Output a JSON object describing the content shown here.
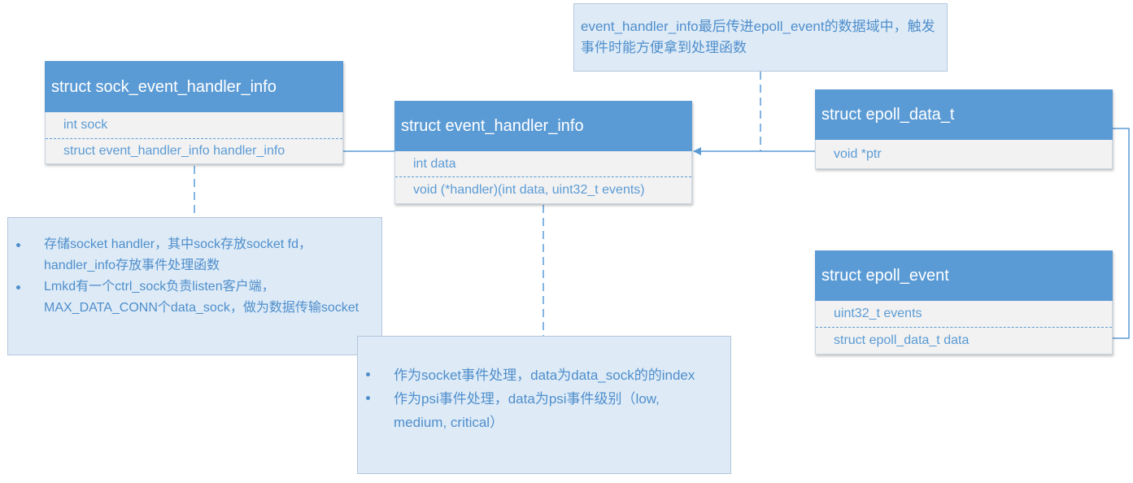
{
  "structs": {
    "sock_event_handler_info": {
      "title": "struct sock_event_handler_info",
      "fields": [
        "int sock",
        "struct event_handler_info handler_info"
      ]
    },
    "event_handler_info": {
      "title": "struct event_handler_info",
      "fields": [
        "int data",
        "void (*handler)(int data, uint32_t events)"
      ]
    },
    "epoll_data_t": {
      "title": "struct epoll_data_t",
      "fields": [
        "void *ptr"
      ]
    },
    "epoll_event": {
      "title": "struct epoll_event",
      "fields": [
        "uint32_t events",
        "struct epoll_data_t data"
      ]
    }
  },
  "notes": {
    "top": "event_handler_info最后传进epoll_event的数据域中，触发事件时能方便拿到处理函数",
    "left": [
      "存储socket handler，其中sock存放socket fd，handler_info存放事件处理函数",
      "Lmkd有一个ctrl_sock负责listen客户端，MAX_DATA_CONN个data_sock，做为数据传输socket"
    ],
    "middle": [
      "作为socket事件处理，data为data_sock的的index",
      "作为psi事件处理，data为psi事件级别（low, medium, critical）"
    ]
  },
  "colors": {
    "header": "#5b9bd5",
    "field_text": "#5b9bd5",
    "field_bg": "#f2f2f2",
    "note_bg": "#deebf7",
    "note_text": "#4f8ecb",
    "connector": "#5b9bd5"
  }
}
